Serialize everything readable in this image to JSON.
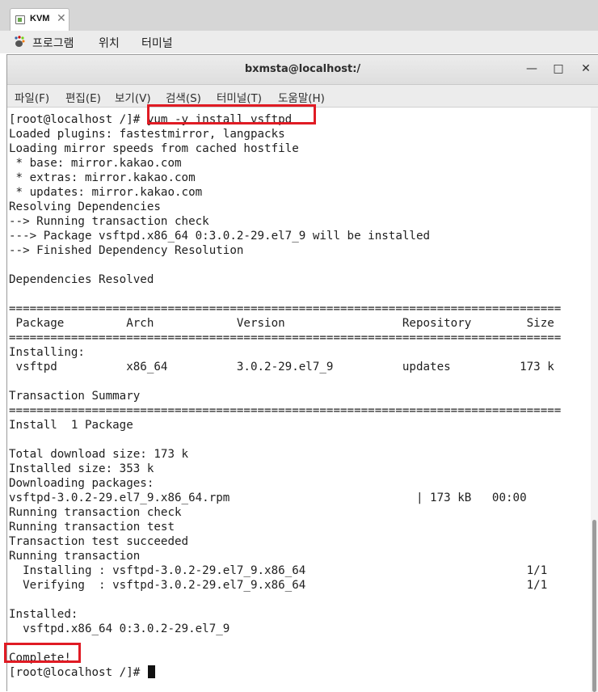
{
  "host_tab": {
    "label": "KVM",
    "icon": "vm-icon",
    "close_glyph": "✕"
  },
  "desktop_panel": {
    "apps_icon": "gnome-foot-icon",
    "items": [
      {
        "label": "프로그램"
      },
      {
        "label": "위치"
      },
      {
        "label": "터미널"
      }
    ]
  },
  "window": {
    "title": "bxmsta@localhost:/",
    "buttons": {
      "minimize": "—",
      "maximize": "□",
      "close": "✕"
    }
  },
  "menubar": {
    "items": [
      {
        "label": "파일(F)"
      },
      {
        "label": "편집(E)"
      },
      {
        "label": "보기(V)"
      },
      {
        "label": "검색(S)"
      },
      {
        "label": "터미널(T)"
      },
      {
        "label": "도움말(H)"
      }
    ]
  },
  "terminal": {
    "lines": [
      "[root@localhost /]# yum -y install vsftpd",
      "Loaded plugins: fastestmirror, langpacks",
      "Loading mirror speeds from cached hostfile",
      " * base: mirror.kakao.com",
      " * extras: mirror.kakao.com",
      " * updates: mirror.kakao.com",
      "Resolving Dependencies",
      "--> Running transaction check",
      "---> Package vsftpd.x86_64 0:3.0.2-29.el7_9 will be installed",
      "--> Finished Dependency Resolution",
      "",
      "Dependencies Resolved",
      "",
      "================================================================================",
      " Package         Arch            Version                 Repository        Size",
      "================================================================================",
      "Installing:",
      " vsftpd          x86_64          3.0.2-29.el7_9          updates          173 k",
      "",
      "Transaction Summary",
      "================================================================================",
      "Install  1 Package",
      "",
      "Total download size: 173 k",
      "Installed size: 353 k",
      "Downloading packages:",
      "vsftpd-3.0.2-29.el7_9.x86_64.rpm                           | 173 kB   00:00",
      "Running transaction check",
      "Running transaction test",
      "Transaction test succeeded",
      "Running transaction",
      "  Installing : vsftpd-3.0.2-29.el7_9.x86_64                                1/1",
      "  Verifying  : vsftpd-3.0.2-29.el7_9.x86_64                                1/1",
      "",
      "Installed:",
      "  vsftpd.x86_64 0:3.0.2-29.el7_9",
      "",
      "Complete!",
      "[root@localhost /]# "
    ]
  },
  "colors": {
    "highlight": "#e01b24",
    "text": "#202020"
  }
}
